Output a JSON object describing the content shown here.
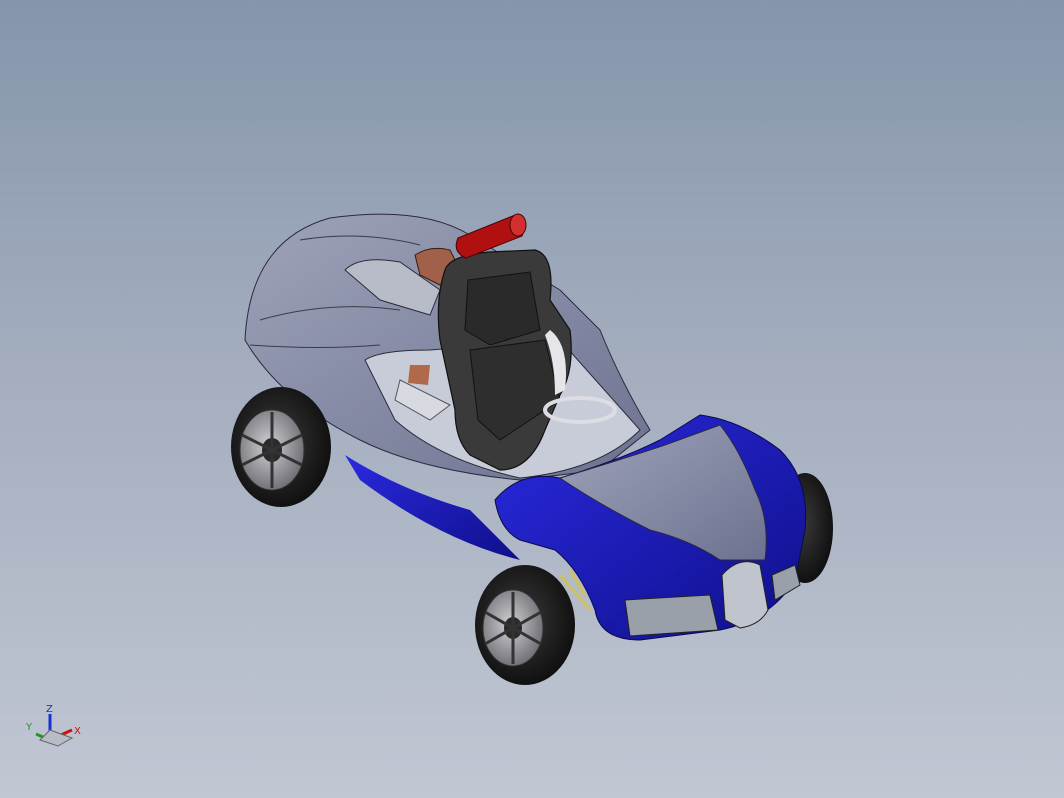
{
  "viewport": {
    "background_top": "#8595ac",
    "background_bottom": "#c1c7d3"
  },
  "model": {
    "body_color_primary": "#8a8fa8",
    "body_color_accent": "#1f1fb5",
    "seat_color": "#3a3a3a",
    "extinguisher_color": "#b01010"
  },
  "triad": {
    "x_label": "X",
    "y_label": "Y",
    "z_label": "Z",
    "x_color": "#d01010",
    "y_color": "#1f9a1f",
    "z_color": "#1a2fd0"
  }
}
